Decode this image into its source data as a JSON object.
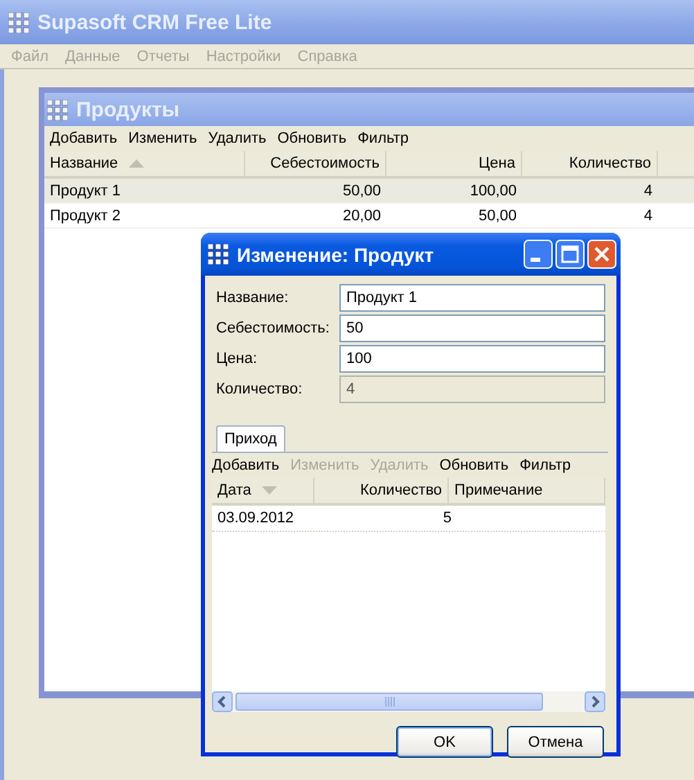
{
  "main_window": {
    "title": "Supasoft CRM Free Lite",
    "active": false
  },
  "menu": [
    "Файл",
    "Данные",
    "Отчеты",
    "Настройки",
    "Справка"
  ],
  "products_window": {
    "title": "Продукты",
    "active": false,
    "toolbar": [
      {
        "label": "Добавить",
        "disabled": false
      },
      {
        "label": "Изменить",
        "disabled": false
      },
      {
        "label": "Удалить",
        "disabled": false
      },
      {
        "label": "Обновить",
        "disabled": false
      },
      {
        "label": "Фильтр",
        "disabled": false
      }
    ],
    "columns": [
      {
        "label": "Название",
        "right_aligned": false,
        "sort_up": true,
        "sort_down": false
      },
      {
        "label": "Себестоимость",
        "right_aligned": true,
        "sort_up": false,
        "sort_down": false
      },
      {
        "label": "Цена",
        "right_aligned": true,
        "sort_up": false,
        "sort_down": false
      },
      {
        "label": "Количество",
        "right_aligned": true,
        "sort_up": false,
        "sort_down": false
      }
    ],
    "rows": [
      {
        "cells": [
          "Продукт 1",
          "50,00",
          "100,00",
          "4"
        ],
        "selected": true
      },
      {
        "cells": [
          "Продукт 2",
          "20,00",
          "50,00",
          "4"
        ],
        "selected": false
      }
    ]
  },
  "dialog": {
    "title": "Изменение: Продукт",
    "active": true,
    "fields": [
      {
        "label": "Название:",
        "value": "Продукт 1",
        "readonly": false
      },
      {
        "label": "Себестоимость:",
        "value": "50",
        "readonly": false
      },
      {
        "label": "Цена:",
        "value": "100",
        "readonly": false
      },
      {
        "label": "Количество:",
        "value": "4",
        "readonly": true
      }
    ],
    "tabs": [
      {
        "label": "Приход",
        "selected": true
      }
    ],
    "toolbar": [
      {
        "label": "Добавить",
        "disabled": false
      },
      {
        "label": "Изменить",
        "disabled": true
      },
      {
        "label": "Удалить",
        "disabled": true
      },
      {
        "label": "Обновить",
        "disabled": false
      },
      {
        "label": "Фильтр",
        "disabled": false
      }
    ],
    "columns": [
      {
        "label": "Дата",
        "right_aligned": false,
        "sort_up": false,
        "sort_down": true
      },
      {
        "label": "Количество",
        "right_aligned": true,
        "sort_up": false,
        "sort_down": false
      },
      {
        "label": "Примечание",
        "right_aligned": false,
        "sort_up": false,
        "sort_down": false
      }
    ],
    "rows": [
      {
        "cells": [
          "03.09.2012",
          "5"
        ],
        "selected": false
      }
    ],
    "buttons": [
      {
        "label": "OK",
        "default": true
      },
      {
        "label": "Отмена",
        "default": false
      }
    ]
  }
}
